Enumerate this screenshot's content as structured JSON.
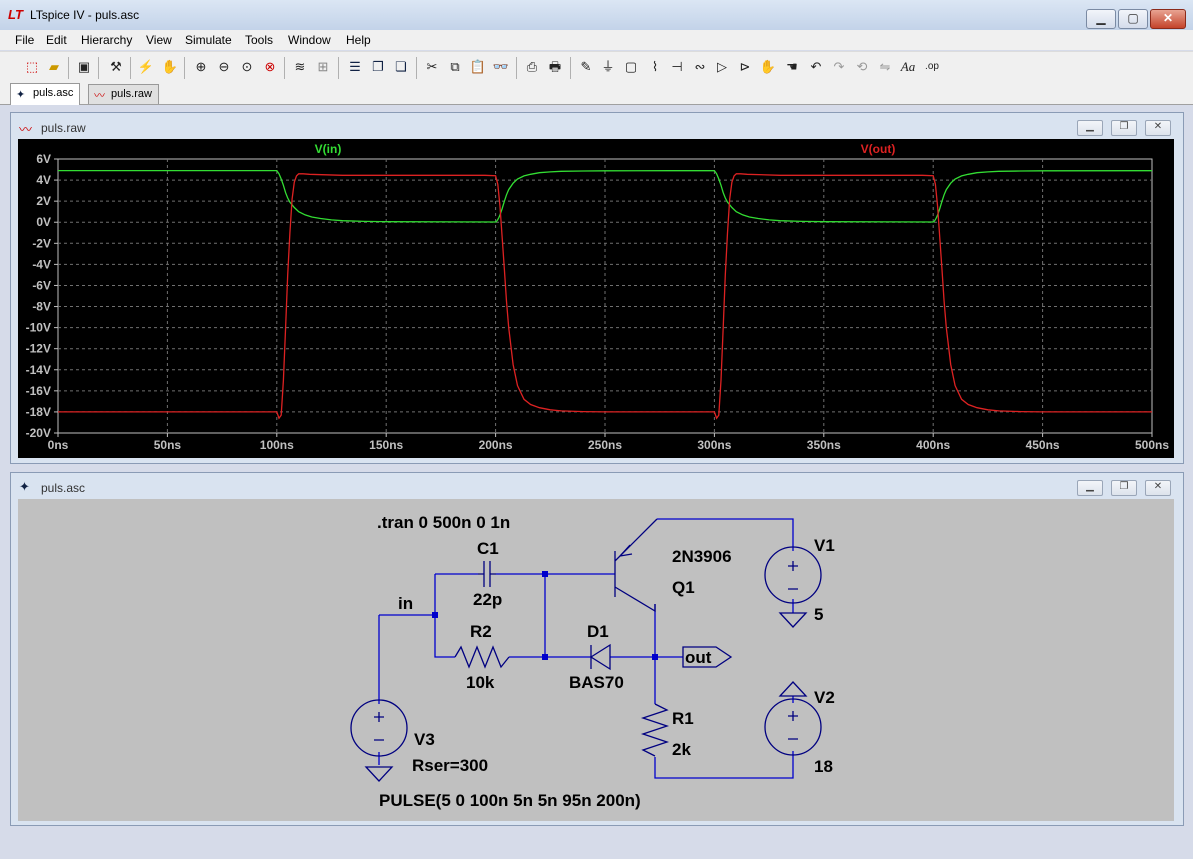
{
  "app": {
    "title": "LTspice IV - puls.asc",
    "logo_text": "LT"
  },
  "menu": [
    "File",
    "Edit",
    "Hierarchy",
    "View",
    "Simulate",
    "Tools",
    "Window",
    "Help"
  ],
  "toolbar_icons": [
    "new-schematic-icon",
    "open-icon",
    "save-icon",
    "control-panel-icon",
    "run-icon",
    "halt-icon",
    "zoom-in-icon",
    "zoom-out-icon",
    "zoom-fit-icon",
    "zoom-cancel-icon",
    "waveform-icon",
    "autorange-icon",
    "tile-horizontal-icon",
    "cascade-icon",
    "tile-vertical-icon",
    "cut-icon",
    "copy-icon",
    "paste-icon",
    "find-icon",
    "print-preview-icon",
    "print-icon",
    "wire-icon",
    "ground-icon",
    "label-net-icon",
    "resistor-icon",
    "capacitor-icon",
    "inductor-icon",
    "diode-icon",
    "component-icon",
    "move-icon",
    "drag-icon",
    "undo-icon",
    "redo-icon",
    "rotate-icon",
    "mirror-icon",
    "text-icon",
    "spice-directive-icon"
  ],
  "toolbar_glyphs": {
    "text": "Aa",
    "spice": ".op"
  },
  "tabs": [
    {
      "label": "puls.asc",
      "active": true
    },
    {
      "label": "puls.raw",
      "active": false
    }
  ],
  "plot_window": {
    "title": "puls.raw"
  },
  "schematic_window": {
    "title": "puls.asc"
  },
  "chart_data": {
    "type": "line",
    "xlabel": "",
    "ylabel": "",
    "x_ticks": [
      "0ns",
      "50ns",
      "100ns",
      "150ns",
      "200ns",
      "250ns",
      "300ns",
      "350ns",
      "400ns",
      "450ns",
      "500ns"
    ],
    "y_ticks": [
      "6V",
      "4V",
      "2V",
      "0V",
      "-2V",
      "-4V",
      "-6V",
      "-8V",
      "-10V",
      "-12V",
      "-14V",
      "-16V",
      "-18V",
      "-20V"
    ],
    "xlim": [
      0,
      500
    ],
    "ylim": [
      -20,
      6
    ],
    "grid": true,
    "series": [
      {
        "name": "V(in)",
        "color": "#33dd33",
        "x": [
          0,
          100,
          101,
          102,
          103,
          104,
          105,
          106,
          108,
          110,
          113,
          116,
          120,
          125,
          130,
          140,
          150,
          180,
          200,
          200.5,
          201,
          201.5,
          202,
          203,
          204,
          205,
          206,
          208,
          210,
          213,
          216,
          220,
          225,
          230,
          240,
          250,
          280,
          300,
          301,
          302,
          303,
          304,
          305,
          306,
          308,
          310,
          313,
          316,
          320,
          325,
          330,
          340,
          350,
          380,
          400,
          400.5,
          401,
          401.5,
          402,
          403,
          404,
          405,
          406,
          408,
          410,
          413,
          416,
          420,
          425,
          430,
          440,
          450,
          500
        ],
        "y": [
          4.9,
          4.9,
          4.6,
          4.1,
          3.5,
          2.8,
          2.3,
          1.9,
          1.4,
          1.0,
          0.7,
          0.5,
          0.35,
          0.22,
          0.15,
          0.08,
          0.05,
          0.03,
          0.02,
          0.1,
          0.25,
          0.45,
          0.7,
          1.3,
          2.0,
          2.6,
          3.1,
          3.7,
          4.1,
          4.4,
          4.55,
          4.7,
          4.78,
          4.83,
          4.86,
          4.88,
          4.89,
          4.9,
          4.6,
          4.1,
          3.5,
          2.8,
          2.3,
          1.9,
          1.4,
          1.0,
          0.7,
          0.5,
          0.35,
          0.22,
          0.15,
          0.08,
          0.05,
          0.03,
          0.02,
          0.1,
          0.25,
          0.45,
          0.7,
          1.3,
          2.0,
          2.6,
          3.1,
          3.7,
          4.1,
          4.4,
          4.55,
          4.7,
          4.78,
          4.83,
          4.86,
          4.88,
          4.89
        ]
      },
      {
        "name": "V(out)",
        "color": "#dd2222",
        "x": [
          0,
          99,
          100,
          101,
          102,
          103,
          104,
          105,
          106,
          107,
          108,
          109,
          110,
          112,
          115,
          130,
          180,
          195,
          200,
          201,
          202,
          203,
          204,
          205,
          206,
          208,
          210,
          213,
          216,
          220,
          225,
          230,
          240,
          250,
          299,
          300,
          301,
          302,
          303,
          304,
          305,
          306,
          307,
          308,
          309,
          310,
          312,
          315,
          330,
          380,
          395,
          400,
          401,
          402,
          403,
          404,
          405,
          406,
          408,
          410,
          413,
          416,
          420,
          425,
          430,
          440,
          450,
          500
        ],
        "y": [
          -18,
          -18,
          -18,
          -18.6,
          -18.3,
          -15,
          -10,
          -5,
          -1,
          2.2,
          3.8,
          4.4,
          4.6,
          4.6,
          4.55,
          4.45,
          4.45,
          4.45,
          4.42,
          3.6,
          1.5,
          -1.5,
          -4.5,
          -7.5,
          -10,
          -13.5,
          -15.5,
          -16.8,
          -17.3,
          -17.6,
          -17.8,
          -17.9,
          -17.97,
          -18,
          -18,
          -18,
          -18.6,
          -18.3,
          -15,
          -10,
          -5,
          -1,
          2.2,
          3.8,
          4.4,
          4.6,
          4.6,
          4.55,
          4.45,
          4.45,
          4.45,
          4.42,
          3.6,
          1.5,
          -1.5,
          -4.5,
          -7.5,
          -10,
          -13.5,
          -15.5,
          -16.8,
          -17.3,
          -17.6,
          -17.8,
          -17.9,
          -17.97,
          -18,
          -18
        ]
      }
    ]
  },
  "schematic": {
    "directive": ".tran 0 500n 0 1n",
    "labels": {
      "c1_name": "C1",
      "c1_value": "22p",
      "r2_name": "R2",
      "r2_value": "10k",
      "d1_name": "D1",
      "d1_value": "BAS70",
      "q1_model": "2N3906",
      "q1_name": "Q1",
      "v1_name": "V1",
      "v1_value": "5",
      "v2_name": "V2",
      "v2_value": "18",
      "r1_name": "R1",
      "r1_value": "2k",
      "v3_name": "V3",
      "v3_rser": "Rser=300",
      "v3_pulse": "PULSE(5 0 100n 5n 5n 95n 200n)",
      "net_in": "in",
      "net_out": "out"
    },
    "wire_color": "#0000cc",
    "symbol_color": "#000080"
  }
}
